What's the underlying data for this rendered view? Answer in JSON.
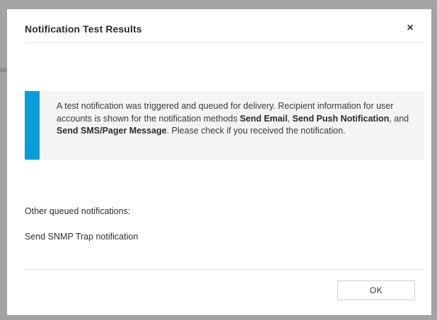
{
  "dialog": {
    "title": "Notification Test Results",
    "close_label": "×",
    "info": {
      "t1": "A test notification was triggered and queued for delivery. Recipient information for user accounts is shown for the notification methods ",
      "b1": "Send Email",
      "t2": ", ",
      "b2": "Send Push Notification",
      "t3": ", and ",
      "b3": "Send SMS/Pager Message",
      "t4": ". Please check if you received the notification."
    },
    "other_label": "Other queued notifications:",
    "other_items": [
      "Send SNMP Trap notification"
    ],
    "ok_label": "OK"
  },
  "colors": {
    "accent": "#0b9bd9",
    "info_background": "#f4f4f4",
    "backdrop": "#a3a3a3"
  }
}
